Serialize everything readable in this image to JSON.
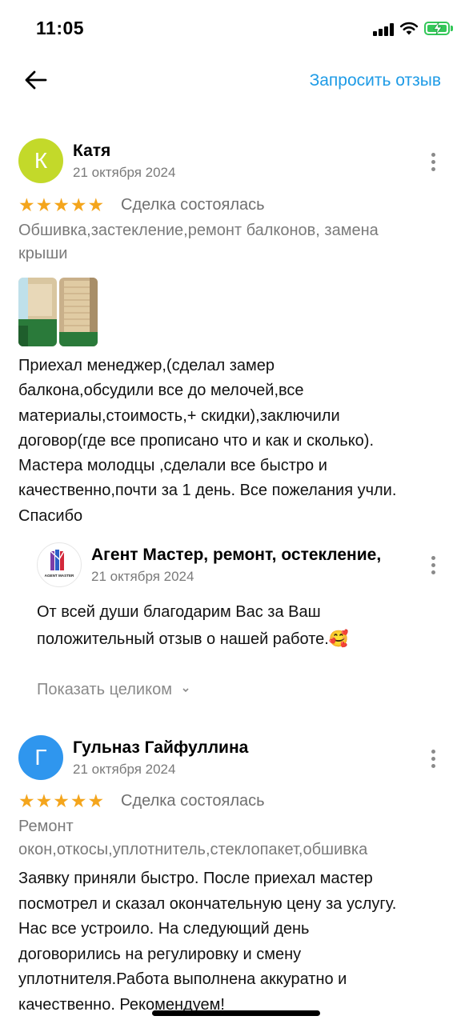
{
  "status_bar": {
    "time": "11:05"
  },
  "header": {
    "request_review_label": "Запросить отзыв"
  },
  "reviews": [
    {
      "avatar_letter": "К",
      "avatar_color": "#c3d92a",
      "author": "Катя",
      "date": "21 октября 2024",
      "rating": 5,
      "stars": "★★★★★",
      "status": "Сделка состоялась",
      "services_lines": [
        "Обшивка,застекление,ремонт балконов, замена",
        "крыши"
      ],
      "photos_count": 2,
      "text_lines": [
        "Приехал менеджер,(сделал замер",
        "балкона,обсудили все до мелочей,все",
        "материалы,стоимость,+ скидки),заключили",
        "договор(где все прописано что и как и сколько).",
        "Мастера молодцы ,сделали все быстро и",
        "качественно,почти за 1 день. Все пожелания учли.",
        "Спасибо"
      ],
      "reply": {
        "logo_text": "AGENT MASTER",
        "author": "Агент Мастер, ремонт, остекление,",
        "date": "21 октября 2024",
        "text_lines": [
          "От всей души благодарим Вас за Ваш",
          "положительный отзыв о нашей работе.🥰"
        ]
      },
      "show_all_label": "Показать целиком"
    },
    {
      "avatar_letter": "Г",
      "avatar_color": "#2f96ee",
      "author": "Гульназ Гайфуллина",
      "date": "21 октября 2024",
      "rating": 5,
      "stars": "★★★★★",
      "status": "Сделка состоялась",
      "services_lines": [
        "Ремонт",
        "окон,откосы,уплотнитель,стеклопакет,обшивка"
      ],
      "text_lines": [
        "Заявку приняли быстро. После приехал мастер",
        "посмотрел и сказал окончательную цену за услугу.",
        "Нас все устроило. На следующий день",
        "договорились на регулировку и смену",
        "уплотнителя.Работа выполнена аккуратно и",
        "качественно. Рекомендуем!"
      ]
    }
  ]
}
